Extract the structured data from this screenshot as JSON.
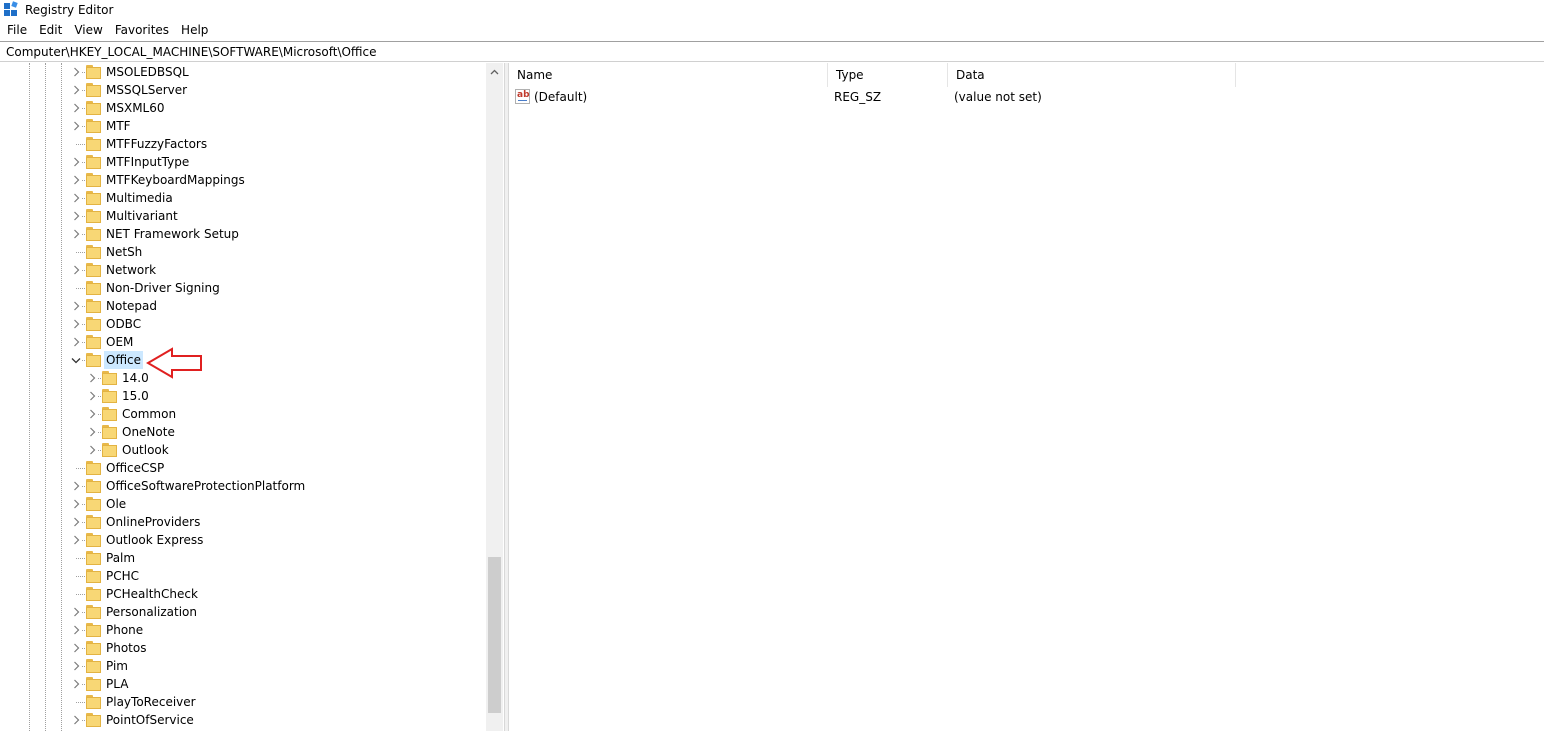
{
  "window": {
    "title": "Registry Editor"
  },
  "menu": [
    "File",
    "Edit",
    "View",
    "Favorites",
    "Help"
  ],
  "address": "Computer\\HKEY_LOCAL_MACHINE\\SOFTWARE\\Microsoft\\Office",
  "tree": {
    "items": [
      {
        "label": "MSOLEDBSQL",
        "level": 1,
        "expander": "collapsed"
      },
      {
        "label": "MSSQLServer",
        "level": 1,
        "expander": "collapsed"
      },
      {
        "label": "MSXML60",
        "level": 1,
        "expander": "collapsed"
      },
      {
        "label": "MTF",
        "level": 1,
        "expander": "collapsed"
      },
      {
        "label": "MTFFuzzyFactors",
        "level": 1,
        "expander": "none"
      },
      {
        "label": "MTFInputType",
        "level": 1,
        "expander": "collapsed"
      },
      {
        "label": "MTFKeyboardMappings",
        "level": 1,
        "expander": "collapsed"
      },
      {
        "label": "Multimedia",
        "level": 1,
        "expander": "collapsed"
      },
      {
        "label": "Multivariant",
        "level": 1,
        "expander": "collapsed"
      },
      {
        "label": "NET Framework Setup",
        "level": 1,
        "expander": "collapsed"
      },
      {
        "label": "NetSh",
        "level": 1,
        "expander": "none"
      },
      {
        "label": "Network",
        "level": 1,
        "expander": "collapsed"
      },
      {
        "label": "Non-Driver Signing",
        "level": 1,
        "expander": "none"
      },
      {
        "label": "Notepad",
        "level": 1,
        "expander": "collapsed"
      },
      {
        "label": "ODBC",
        "level": 1,
        "expander": "collapsed"
      },
      {
        "label": "OEM",
        "level": 1,
        "expander": "collapsed"
      },
      {
        "label": "Office",
        "level": 1,
        "expander": "expanded",
        "selected": true
      },
      {
        "label": "14.0",
        "level": 2,
        "expander": "collapsed"
      },
      {
        "label": "15.0",
        "level": 2,
        "expander": "collapsed"
      },
      {
        "label": "Common",
        "level": 2,
        "expander": "collapsed"
      },
      {
        "label": "OneNote",
        "level": 2,
        "expander": "collapsed"
      },
      {
        "label": "Outlook",
        "level": 2,
        "expander": "collapsed"
      },
      {
        "label": "OfficeCSP",
        "level": 1,
        "expander": "none"
      },
      {
        "label": "OfficeSoftwareProtectionPlatform",
        "level": 1,
        "expander": "collapsed"
      },
      {
        "label": "Ole",
        "level": 1,
        "expander": "collapsed"
      },
      {
        "label": "OnlineProviders",
        "level": 1,
        "expander": "collapsed"
      },
      {
        "label": "Outlook Express",
        "level": 1,
        "expander": "collapsed"
      },
      {
        "label": "Palm",
        "level": 1,
        "expander": "none"
      },
      {
        "label": "PCHC",
        "level": 1,
        "expander": "none"
      },
      {
        "label": "PCHealthCheck",
        "level": 1,
        "expander": "none"
      },
      {
        "label": "Personalization",
        "level": 1,
        "expander": "collapsed"
      },
      {
        "label": "Phone",
        "level": 1,
        "expander": "collapsed"
      },
      {
        "label": "Photos",
        "level": 1,
        "expander": "collapsed"
      },
      {
        "label": "Pim",
        "level": 1,
        "expander": "collapsed"
      },
      {
        "label": "PLA",
        "level": 1,
        "expander": "collapsed"
      },
      {
        "label": "PlayToReceiver",
        "level": 1,
        "expander": "none"
      },
      {
        "label": "PointOfService",
        "level": 1,
        "expander": "collapsed"
      }
    ]
  },
  "values": {
    "columns": [
      "Name",
      "Type",
      "Data"
    ],
    "rows": [
      {
        "name": "(Default)",
        "type": "REG_SZ",
        "data": "(value not set)",
        "icon": "string-value-icon"
      }
    ]
  },
  "colors": {
    "selection": "#cce8ff",
    "annotation": "#e02020",
    "folder": "#f8d775"
  },
  "annotation": {
    "icon": "red-arrow-pointing-left-icon"
  }
}
